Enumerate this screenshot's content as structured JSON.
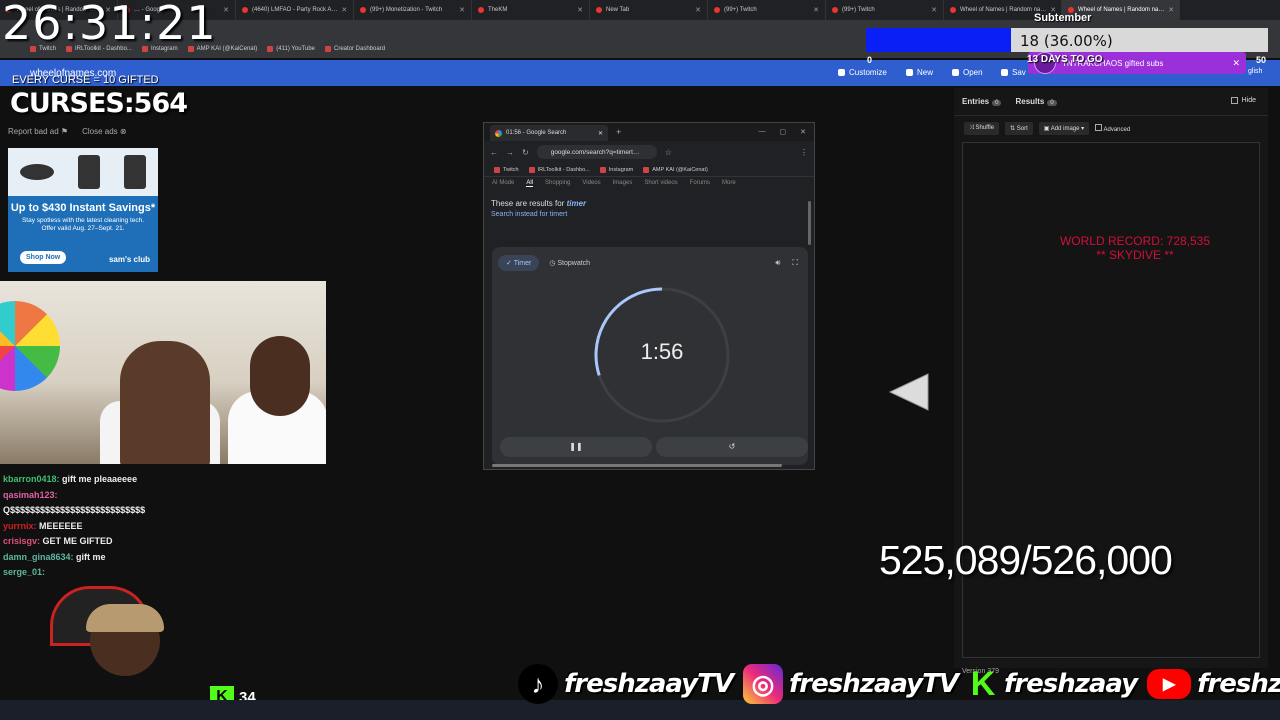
{
  "browser": {
    "tabs": [
      {
        "label": "Wheel of Names | Random n…"
      },
      {
        "label": "… - Google"
      },
      {
        "label": "(4640) LMFAO - Party Rock A…"
      },
      {
        "label": "(99+) Monetization - Twitch"
      },
      {
        "label": "TheKM"
      },
      {
        "label": "New Tab"
      },
      {
        "label": "(99+) Twitch"
      },
      {
        "label": "(99+) Twitch"
      },
      {
        "label": "Wheel of Names | Random na…"
      },
      {
        "label": "Wheel of Names | Random na…"
      }
    ],
    "bookmarks": [
      "Twitch",
      "IRLToolkit - Dashbo...",
      "Instagram",
      "AMP KAI (@KaiCenat)",
      "(411) YouTube",
      "Creator Dashboard"
    ]
  },
  "overlay": {
    "clock": "26:31:21",
    "curse_note": "EVERY CURSE = 10 GIFTED",
    "curses": "CURSES:564",
    "subtember_title": "Subtember",
    "goal_text": "18 (36.00%)",
    "goal_fraction": 0.36,
    "goal_min": "0",
    "goal_max": "50",
    "days_left": "13 DAYS TO GO",
    "kick_count": "34",
    "big_counter": "525,089/526,000",
    "world_record": "WORLD RECORD: 728,535",
    "world_record_sub": "** SKYDIVE **"
  },
  "wheelbar": {
    "site": "wheelofnames.com",
    "customize": "Customize",
    "new": "New",
    "open": "Open",
    "save": "Sav",
    "lang": "glish"
  },
  "ad": {
    "report": "Report bad ad",
    "close": "Close ads",
    "headline": "Up to $430 Instant Savings*",
    "sub1": "Stay spotless with the latest cleaning tech.",
    "sub2": "Offer valid Aug. 27–Sept. 21.",
    "shop": "Shop Now",
    "brand": "sam's club"
  },
  "chat": [
    {
      "user": "kbarron0418",
      "msg": "gift me pleaaeeee",
      "color": "#3fbf6f"
    },
    {
      "user": "qasimah123",
      "msg": "",
      "color": "#e060a0"
    },
    {
      "user": "",
      "msg": "Q$$$$$$$$$$$$$$$$$$$$$$$$$$$",
      "color": "#ffffff"
    },
    {
      "user": "yurrnix",
      "msg": "MEEEEEE",
      "color": "#d02020"
    },
    {
      "user": "crisisgv",
      "msg": "GET ME GIFTED",
      "color": "#e0507a"
    },
    {
      "user": "damn_gina8634",
      "msg": "gift me",
      "color": "#5fb6a0"
    },
    {
      "user": "serge_01",
      "msg": "",
      "color": "#5fb6a0"
    }
  ],
  "gwin": {
    "tab_title": "01:56 - Google Search",
    "url": "google.com/search?q=timert…",
    "bookmarks": [
      "Twitch",
      "IRLToolkit - Dashbo...",
      "Instagram",
      "AMP KAI (@KaiCenat)"
    ],
    "search_tabs": [
      "AI Mode",
      "All",
      "Shopping",
      "Videos",
      "Images",
      "Short videos",
      "Forums",
      "More"
    ],
    "results_for": "These are results for",
    "results_term": "timer",
    "instead": "Search instead for",
    "instead_term": "timert",
    "timer_tab": "Timer",
    "stopwatch_tab": "Stopwatch",
    "timer_value": "1:56",
    "timer_progress": 0.3
  },
  "panel": {
    "entries": "Entries",
    "entries_count": "0",
    "results": "Results",
    "results_count": "0",
    "hide": "Hide",
    "shuffle": "Shuffle",
    "sort": "Sort",
    "add_image": "Add image",
    "advanced": "Advanced",
    "footer": "Version 379"
  },
  "gift": {
    "text": "TNTRAKCHAOS gifted subs"
  },
  "socials": {
    "name1": "freshzaayTV",
    "name2": "freshzaayTV",
    "name3": "freshzaay",
    "name4": "freshzaay"
  }
}
